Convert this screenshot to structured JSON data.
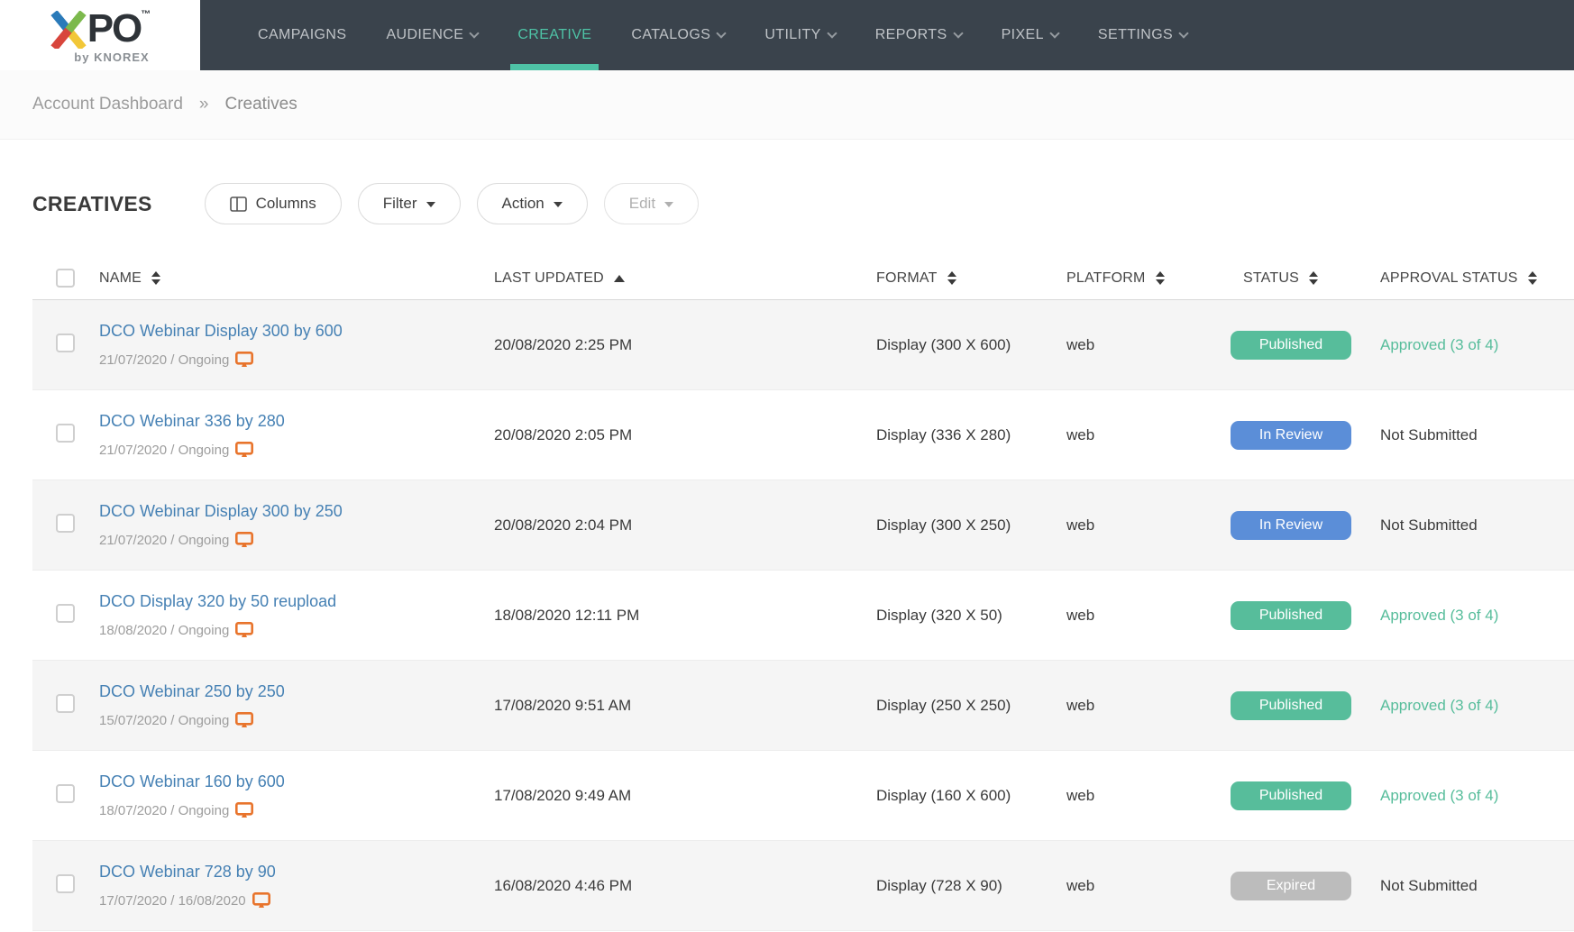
{
  "brand": {
    "logo_po": "PO",
    "logo_tm": "TM",
    "logo_sub": "by KNOREX"
  },
  "nav": {
    "items": [
      {
        "label": "CAMPAIGNS",
        "caret": false,
        "active": false
      },
      {
        "label": "AUDIENCE",
        "caret": true,
        "active": false
      },
      {
        "label": "CREATIVE",
        "caret": false,
        "active": true
      },
      {
        "label": "CATALOGS",
        "caret": true,
        "active": false
      },
      {
        "label": "UTILITY",
        "caret": true,
        "active": false
      },
      {
        "label": "REPORTS",
        "caret": true,
        "active": false
      },
      {
        "label": "PIXEL",
        "caret": true,
        "active": false
      },
      {
        "label": "SETTINGS",
        "caret": true,
        "active": false
      }
    ]
  },
  "breadcrumb": {
    "home": "Account Dashboard",
    "separator": "»",
    "current": "Creatives"
  },
  "toolbar": {
    "title": "CREATIVES",
    "columns": "Columns",
    "filter": "Filter",
    "action": "Action",
    "edit": "Edit"
  },
  "table": {
    "columns": [
      {
        "label": "NAME",
        "sort": "both"
      },
      {
        "label": "LAST UPDATED",
        "sort": "asc"
      },
      {
        "label": "FORMAT",
        "sort": "both"
      },
      {
        "label": "PLATFORM",
        "sort": "both"
      },
      {
        "label": "STATUS",
        "sort": "both"
      },
      {
        "label": "APPROVAL STATUS",
        "sort": "both"
      }
    ],
    "rows": [
      {
        "name": "DCO Webinar Display 300 by 600",
        "schedule": "21/07/2020  /  Ongoing",
        "last_updated": "20/08/2020 2:25 PM",
        "format": "Display (300 X 600)",
        "platform": "web",
        "status": "Published",
        "approval": "Approved (3 of 4)"
      },
      {
        "name": "DCO Webinar 336 by 280",
        "schedule": "21/07/2020  /  Ongoing",
        "last_updated": "20/08/2020 2:05 PM",
        "format": "Display (336 X 280)",
        "platform": "web",
        "status": "In Review",
        "approval": "Not Submitted"
      },
      {
        "name": "DCO Webinar Display 300 by 250",
        "schedule": "21/07/2020  /  Ongoing",
        "last_updated": "20/08/2020 2:04 PM",
        "format": "Display (300 X 250)",
        "platform": "web",
        "status": "In Review",
        "approval": "Not Submitted"
      },
      {
        "name": "DCO Display 320 by 50 reupload",
        "schedule": "18/08/2020  /  Ongoing",
        "last_updated": "18/08/2020 12:11 PM",
        "format": "Display (320 X 50)",
        "platform": "web",
        "status": "Published",
        "approval": "Approved (3 of 4)"
      },
      {
        "name": "DCO Webinar 250 by 250",
        "schedule": "15/07/2020  /  Ongoing",
        "last_updated": "17/08/2020 9:51 AM",
        "format": "Display (250 X 250)",
        "platform": "web",
        "status": "Published",
        "approval": "Approved (3 of 4)"
      },
      {
        "name": "DCO Webinar 160 by 600",
        "schedule": "18/07/2020  /  Ongoing",
        "last_updated": "17/08/2020 9:49 AM",
        "format": "Display (160 X 600)",
        "platform": "web",
        "status": "Published",
        "approval": "Approved (3 of 4)"
      },
      {
        "name": "DCO Webinar 728 by 90",
        "schedule": "17/07/2020  /  16/08/2020",
        "last_updated": "16/08/2020 4:46 PM",
        "format": "Display (728 X 90)",
        "platform": "web",
        "status": "Expired",
        "approval": "Not Submitted"
      }
    ]
  },
  "colors": {
    "nav_bg": "#3a434c",
    "accent_teal": "#4ec3a6",
    "link_blue": "#4681b4",
    "published_green": "#57bd9b",
    "review_blue": "#5b8ed8",
    "expired_gray": "#bcbcbc",
    "icon_orange": "#e8742c"
  }
}
